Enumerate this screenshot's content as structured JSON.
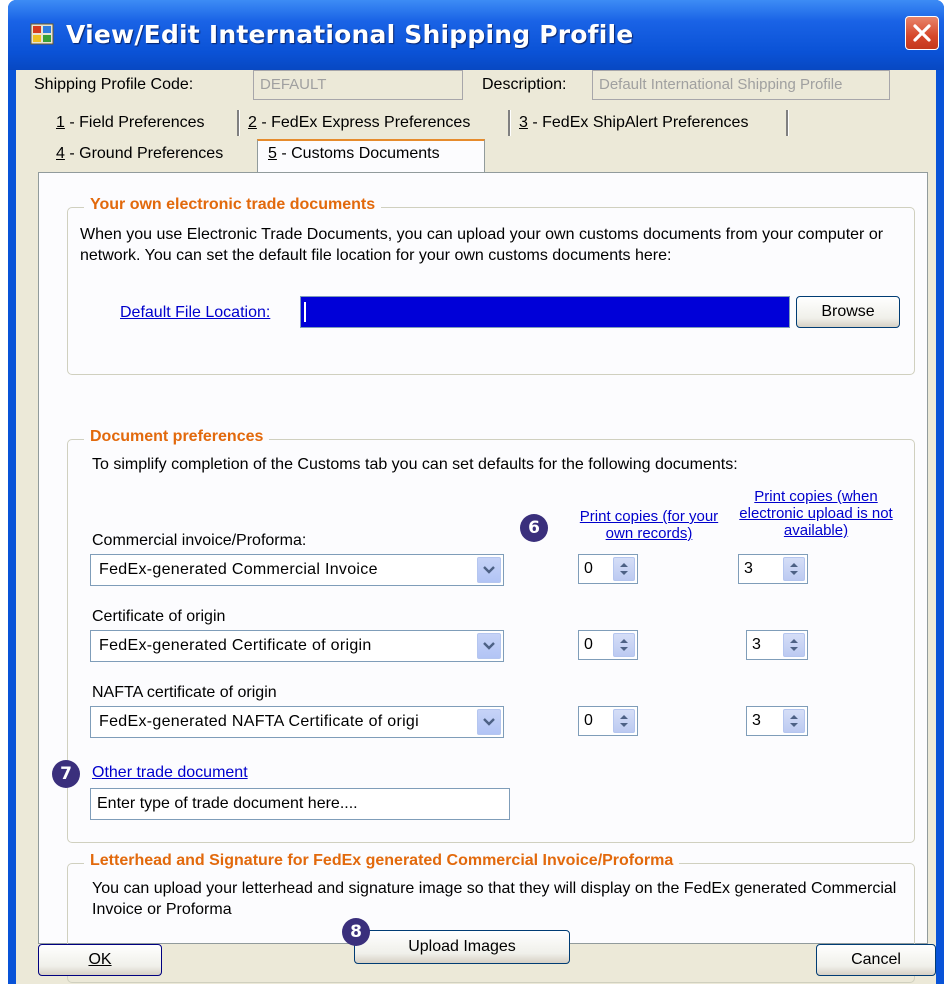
{
  "window": {
    "title": "View/Edit International Shipping Profile"
  },
  "profile": {
    "code_label": "Shipping Profile Code:",
    "code_value": "DEFAULT",
    "description_label": "Description:",
    "description_value": "Default International Shipping Profile"
  },
  "tabs": [
    {
      "key": "1",
      "label": " - Field Preferences"
    },
    {
      "key": "2",
      "label": " - FedEx Express Preferences"
    },
    {
      "key": "3",
      "label": " - FedEx ShipAlert Preferences"
    },
    {
      "key": "4",
      "label": " - Ground Preferences"
    },
    {
      "key": "5",
      "label": " - Customs Documents",
      "active": true
    }
  ],
  "own_docs": {
    "title": "Your own electronic trade documents",
    "description": "When you use Electronic Trade Documents, you can upload your own customs documents from your computer or network.  You can set the default file location for your own customs documents here:",
    "file_location_label": "Default File Location:",
    "file_location_value": "",
    "browse_label": "Browse"
  },
  "doc_prefs": {
    "title": "Document preferences",
    "description": "To simplify completion of the Customs tab you can set defaults for the following documents:",
    "col_own_records": "Print copies (for your own records)",
    "col_no_upload": "Print copies (when electronic upload is not available)",
    "rows": [
      {
        "label": "Commercial invoice/Proforma:",
        "value": "FedEx-generated Commercial Invoice",
        "own_copies": "0",
        "upload_copies": "3"
      },
      {
        "label": "Certificate of origin",
        "value": "FedEx-generated Certificate of origin",
        "own_copies": "0",
        "upload_copies": "3"
      },
      {
        "label": "NAFTA certificate of origin",
        "value": "FedEx-generated NAFTA Certificate of origi",
        "own_copies": "0",
        "upload_copies": "3"
      }
    ],
    "other_label": "Other trade document",
    "other_value": "Enter type of trade document here...."
  },
  "letterhead": {
    "title": "Letterhead and Signature for FedEx generated Commercial Invoice/Proforma",
    "description": "You can upload your letterhead and signature image so that they will display on the FedEx generated Commercial Invoice or Proforma",
    "upload_label": "Upload Images"
  },
  "callouts": {
    "print_copies": "6",
    "other_doc": "7",
    "upload": "8"
  },
  "footer": {
    "ok_label": "OK",
    "cancel_label": "Cancel"
  }
}
